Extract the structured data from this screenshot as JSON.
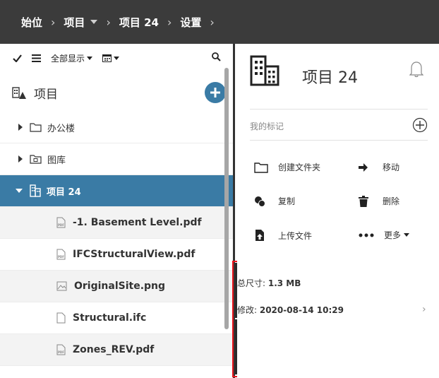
{
  "breadcrumb": {
    "items": [
      {
        "label": "始位"
      },
      {
        "label": "项目"
      },
      {
        "label": "项目 24"
      },
      {
        "label": "设置"
      }
    ]
  },
  "toolbar": {
    "show_all_label": "全部显示"
  },
  "project_header": {
    "label": "项目"
  },
  "tree": {
    "items": [
      {
        "label": "办公楼"
      },
      {
        "label": "图库"
      },
      {
        "label": "项目 24"
      }
    ],
    "files": [
      {
        "label": "-1. Basement Level.pdf"
      },
      {
        "label": "IFCStructuralView.pdf"
      },
      {
        "label": "OriginalSite.png"
      },
      {
        "label": "Structural.ifc"
      },
      {
        "label": "Zones_REV.pdf"
      }
    ]
  },
  "detail": {
    "title": "项目 24",
    "my_tags_label": "我的标记",
    "actions": {
      "create_folder": "创建文件夹",
      "move": "移动",
      "copy": "复制",
      "delete": "删除",
      "upload": "上传文件",
      "more": "更多"
    },
    "size_label": "总尺寸: ",
    "size_value": "1.3 MB",
    "modified_label": "修改: ",
    "modified_value": "2020-08-14 10:29"
  }
}
